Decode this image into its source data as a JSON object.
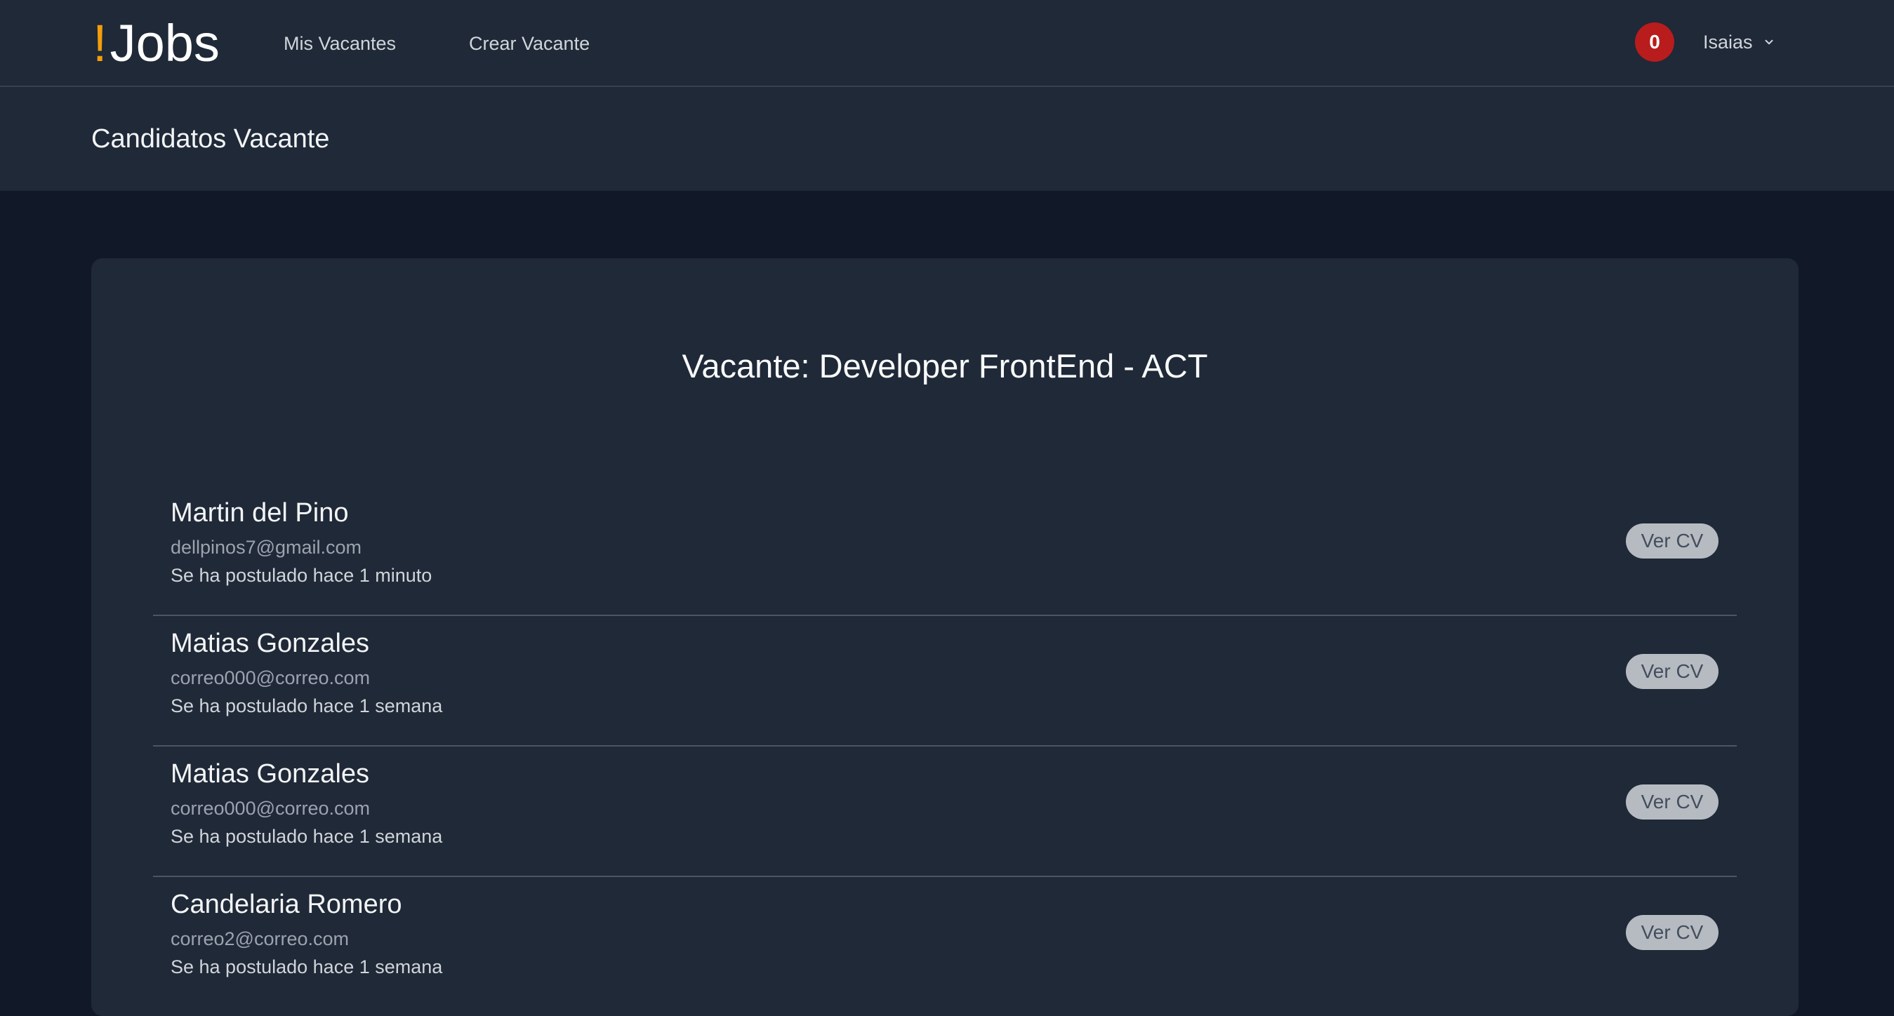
{
  "app": {
    "logo_mark": "!",
    "logo_text": "Jobs"
  },
  "nav": {
    "links": [
      {
        "label": "Mis Vacantes"
      },
      {
        "label": "Crear Vacante"
      }
    ],
    "notifications_count": "0",
    "user_name": "Isaias"
  },
  "header": {
    "title": "Candidatos Vacante"
  },
  "vacante": {
    "title": "Vacante: Developer FrontEnd - ACT"
  },
  "candidates": [
    {
      "name": "Martin del Pino",
      "email": "dellpinos7@gmail.com",
      "applied": "Se ha postulado hace 1 minuto",
      "cv_label": "Ver CV"
    },
    {
      "name": "Matias Gonzales",
      "email": "correo000@correo.com",
      "applied": "Se ha postulado hace 1 semana",
      "cv_label": "Ver CV"
    },
    {
      "name": "Matias Gonzales",
      "email": "correo000@correo.com",
      "applied": "Se ha postulado hace 1 semana",
      "cv_label": "Ver CV"
    },
    {
      "name": "Candelaria Romero",
      "email": "correo2@correo.com",
      "applied": "Se ha postulado hace 1 semana",
      "cv_label": "Ver CV"
    }
  ],
  "icons": {
    "user_menu": "chevron-down-icon"
  },
  "colors": {
    "accent": "#f59e0b",
    "badge": "#b91c1c",
    "background": "#111827",
    "surface": "#1f2937"
  }
}
